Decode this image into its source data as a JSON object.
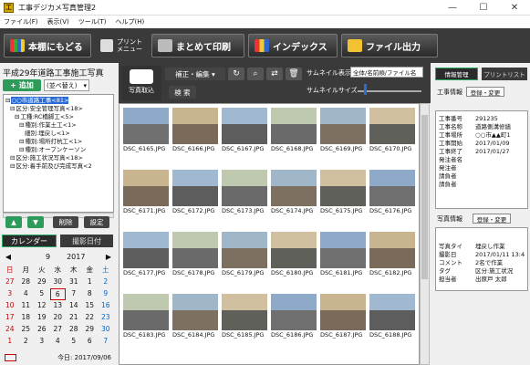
{
  "window": {
    "title": "工事デジカメ写真管理2",
    "app_icon": "工"
  },
  "menu": [
    "ファイル(F)",
    "表示(V)",
    "ツール(T)",
    "ヘルプ(H)"
  ],
  "toolbar": {
    "back": "本棚にもどる",
    "print_menu": "プリント\nメニュー",
    "bulk_print": "まとめて印刷",
    "index": "インデックス",
    "export": "ファイル出力"
  },
  "left": {
    "project_title": "平成29年道路工事施工写真",
    "add_label": "+ 追加",
    "sort_label": "(並べ替え)",
    "tree": [
      {
        "indent": 0,
        "label": "○○市道路工事<81>",
        "selected": true
      },
      {
        "indent": 1,
        "label": "区分:安全管理写真<18>"
      },
      {
        "indent": 2,
        "label": "工種:RC橋脚工<5>"
      },
      {
        "indent": 3,
        "label": "種別:作業土工<1>"
      },
      {
        "indent": 4,
        "label": "細別:埋戻し<1>"
      },
      {
        "indent": 3,
        "label": "種別:場所打杭工<1>"
      },
      {
        "indent": 3,
        "label": "種別:オープンケーソン"
      },
      {
        "indent": 1,
        "label": "区分:施工状況写真<18>"
      },
      {
        "indent": 1,
        "label": "区分:着手前及び完成写真<2"
      }
    ],
    "up_label": "▲",
    "down_label": "▼",
    "delete_label": "削除",
    "settings_label": "設定",
    "calendar_tab": "カレンダー",
    "shoot_date_tab": "撮影日付",
    "calendar": {
      "month": "9",
      "year": "2017",
      "weekdays": [
        "日",
        "月",
        "火",
        "水",
        "木",
        "金",
        "土"
      ],
      "weeks": [
        [
          "27",
          "28",
          "29",
          "30",
          "31",
          "1",
          "2"
        ],
        [
          "3",
          "4",
          "5",
          "6",
          "7",
          "8",
          "9"
        ],
        [
          "10",
          "11",
          "12",
          "13",
          "14",
          "15",
          "16"
        ],
        [
          "17",
          "18",
          "19",
          "20",
          "21",
          "22",
          "23"
        ],
        [
          "24",
          "25",
          "26",
          "27",
          "28",
          "29",
          "30"
        ],
        [
          "1",
          "2",
          "3",
          "4",
          "5",
          "6",
          "7"
        ]
      ],
      "today_label": "今日: 2017/09/06"
    }
  },
  "center": {
    "photo_import": "写真取込",
    "edit_label": "補正・編集 ▾",
    "search_label": "検 索",
    "thumb_display_label": "サムネイル表示",
    "thumb_display_value": "全体/名前順/ファイル名",
    "thumb_size_label": "サムネイルサイズ",
    "thumb_size": 0.1,
    "rows": [
      [
        "DSC_6165.JPG",
        "DSC_6166.JPG",
        "DSC_6167.JPG",
        "DSC_6168.JPG",
        "DSC_6169.JPG",
        "DSC_6170.JPG"
      ],
      [
        "DSC_6171.JPG",
        "DSC_6172.JPG",
        "DSC_6173.JPG",
        "DSC_6174.JPG",
        "DSC_6175.JPG",
        "DSC_6176.JPG"
      ],
      [
        "DSC_6177.JPG",
        "DSC_6178.JPG",
        "DSC_6179.JPG",
        "DSC_6180.JPG",
        "DSC_6181.JPG",
        "DSC_6182.JPG"
      ],
      [
        "DSC_6183.JPG",
        "DSC_6184.JPG",
        "DSC_6185.JPG",
        "DSC_6186.JPG",
        "DSC_6187.JPG",
        "DSC_6188.JPG"
      ]
    ]
  },
  "right": {
    "tab_info": "情報管理",
    "tab_print": "プリントリスト",
    "work_info_label": "工事情報",
    "work_edit": "登録・変更",
    "work_info": [
      {
        "k": "工事番号",
        "v": "291235"
      },
      {
        "k": "工事名称",
        "v": "道路側溝修繕"
      },
      {
        "k": "工事場所",
        "v": "○○市▲▲町1"
      },
      {
        "k": "工事開始",
        "v": "2017/01/09"
      },
      {
        "k": "工事終了",
        "v": "2017/01/27"
      },
      {
        "k": "発注者名",
        "v": ""
      },
      {
        "k": "発注者",
        "v": ""
      },
      {
        "k": "請負者",
        "v": ""
      },
      {
        "k": "請負者",
        "v": ""
      }
    ],
    "photo_info_label": "写真情報",
    "photo_edit": "登録・変更",
    "photo_info": [
      {
        "k": "写真タイ",
        "v": "埋戻し作業"
      },
      {
        "k": "撮影日",
        "v": "2017/01/11 13:4"
      },
      {
        "k": "コメント",
        "v": "2名で作業"
      },
      {
        "k": "タグ",
        "v": "区分:施工状況"
      },
      {
        "k": "担当者",
        "v": "出原戸 太郎"
      }
    ]
  }
}
